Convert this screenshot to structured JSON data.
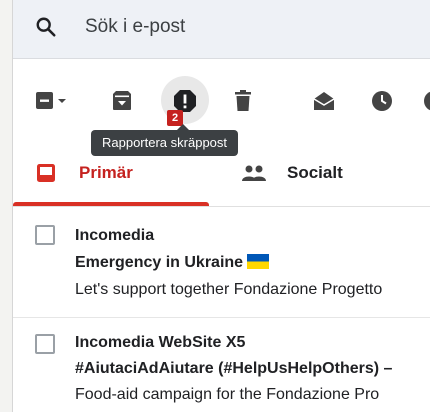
{
  "search": {
    "placeholder": "Sök i e-post"
  },
  "toolbar": {
    "tooltip": "Rapportera skräppost",
    "spam_badge": "2"
  },
  "tabs": [
    {
      "label": "Primär",
      "selected": true
    },
    {
      "label": "Socialt",
      "selected": false
    }
  ],
  "emails": [
    {
      "sender": "Incomedia",
      "subject": "Emergency in Ukraine",
      "snippet": "Let's support together Fondazione Progetto"
    },
    {
      "sender": "Incomedia WebSite X5",
      "subject": "#AiutaciAdAiutare (#HelpUsHelpOthers) –",
      "snippet": "Food-aid campaign for the Fondazione Pro"
    }
  ],
  "colors": {
    "accent": "#d93025",
    "tooltip_bg": "#3c4043",
    "search_bg": "#eef1f6",
    "flag_blue": "#0057b7",
    "flag_yellow": "#ffd700"
  }
}
